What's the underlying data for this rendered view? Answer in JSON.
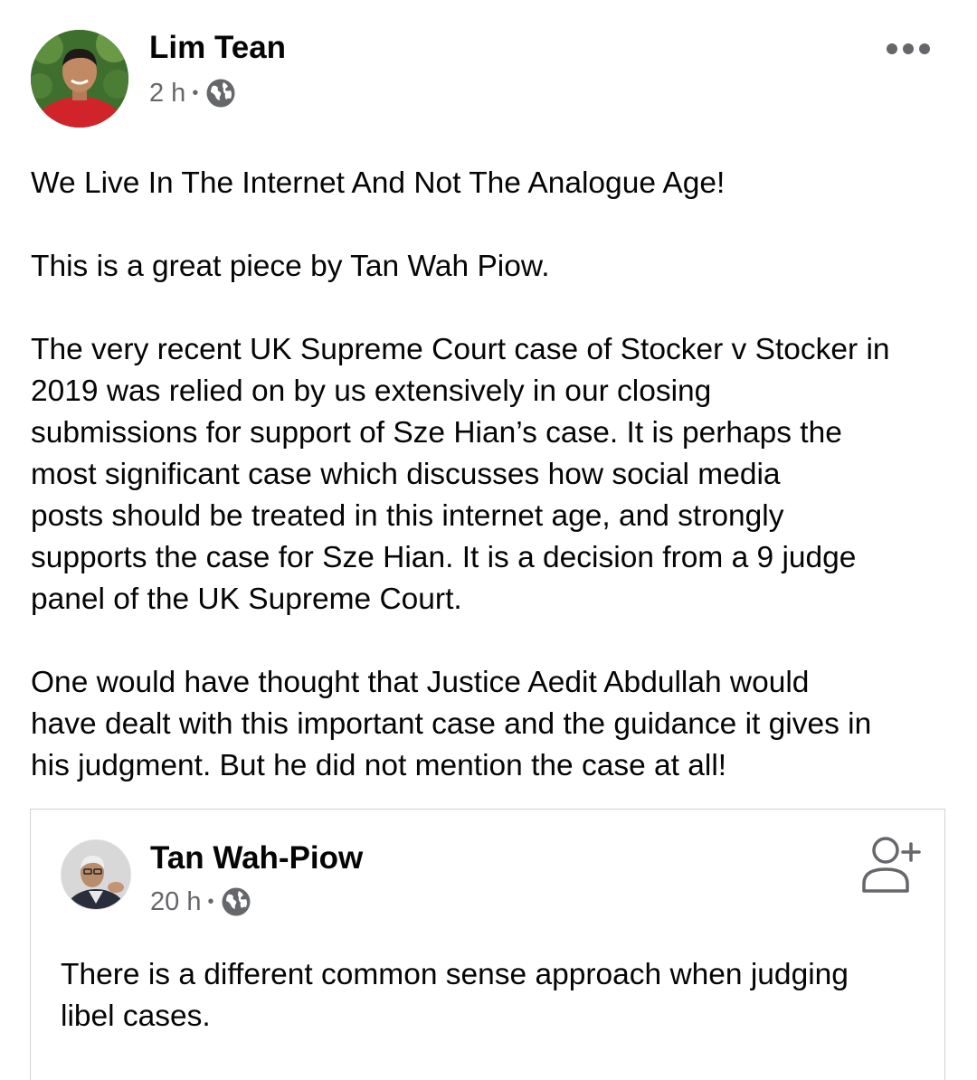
{
  "post": {
    "author_name": "Lim Tean",
    "timestamp": "2 h",
    "separator": "•",
    "privacy_icon": "globe-icon",
    "more_icon": "more-options-icon",
    "paragraphs": [
      "We Live In The Internet And Not The Analogue Age!",
      "This is a great piece by Tan Wah Piow.",
      "The very recent UK Supreme Court case of Stocker v Stocker in\n2019 was relied on by us extensively in our closing\nsubmissions for support of Sze Hian’s case. It is perhaps the\nmost significant case which discusses how social media\nposts should be treated in this internet age, and strongly\nsupports the case for Sze Hian. It is a decision from a 9 judge\npanel of the UK Supreme Court.",
      "One would have thought that Justice Aedit Abdullah would\nhave dealt with this important case and the guidance it gives in\nhis judgment. But he did not mention the case at all!"
    ]
  },
  "shared_post": {
    "author_name": "Tan Wah-Piow",
    "timestamp": "20 h",
    "separator": "•",
    "privacy_icon": "globe-icon",
    "add_friend_icon": "add-friend-icon",
    "text": "There is a different common sense approach when judging\nlibel cases."
  },
  "colors": {
    "text": "#050505",
    "secondary": "#65676b",
    "border": "#d0d2d6"
  }
}
